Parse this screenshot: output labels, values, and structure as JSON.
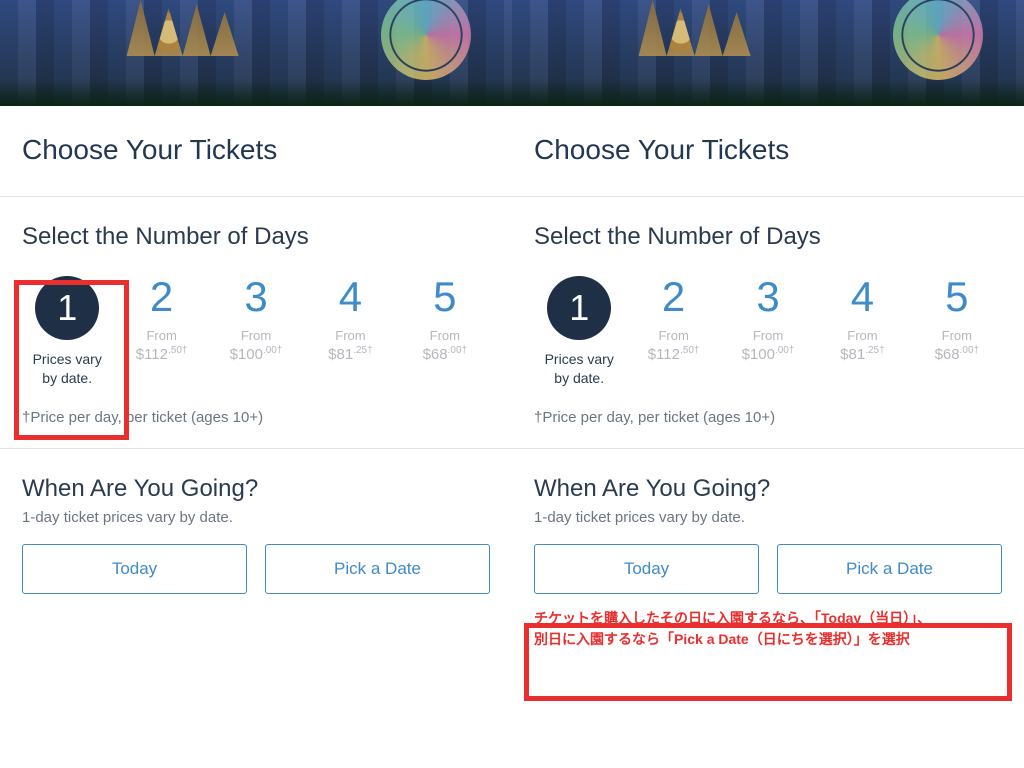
{
  "title": "Choose Your Tickets",
  "select_days_heading": "Select the Number of Days",
  "from_label": "From",
  "days": [
    {
      "n": "1",
      "note_line1": "Prices vary",
      "note_line2": "by date."
    },
    {
      "n": "2",
      "price_whole": "$112",
      "price_cents": ".50†"
    },
    {
      "n": "3",
      "price_whole": "$100",
      "price_cents": ".00†"
    },
    {
      "n": "4",
      "price_whole": "$81",
      "price_cents": ".25†"
    },
    {
      "n": "5",
      "price_whole": "$68",
      "price_cents": ".00†"
    }
  ],
  "footnote": "†Price per day, per ticket (ages 10+)",
  "when_heading": "When Are You Going?",
  "when_sub": "1-day ticket prices vary by date.",
  "btn_today": "Today",
  "btn_pick": "Pick a Date",
  "caption_line1": "チケットを購入したその日に入園するなら、「Today（当日）」、",
  "caption_line2": "別日に入園するなら「Pick a Date（日にちを選択）」を選択"
}
